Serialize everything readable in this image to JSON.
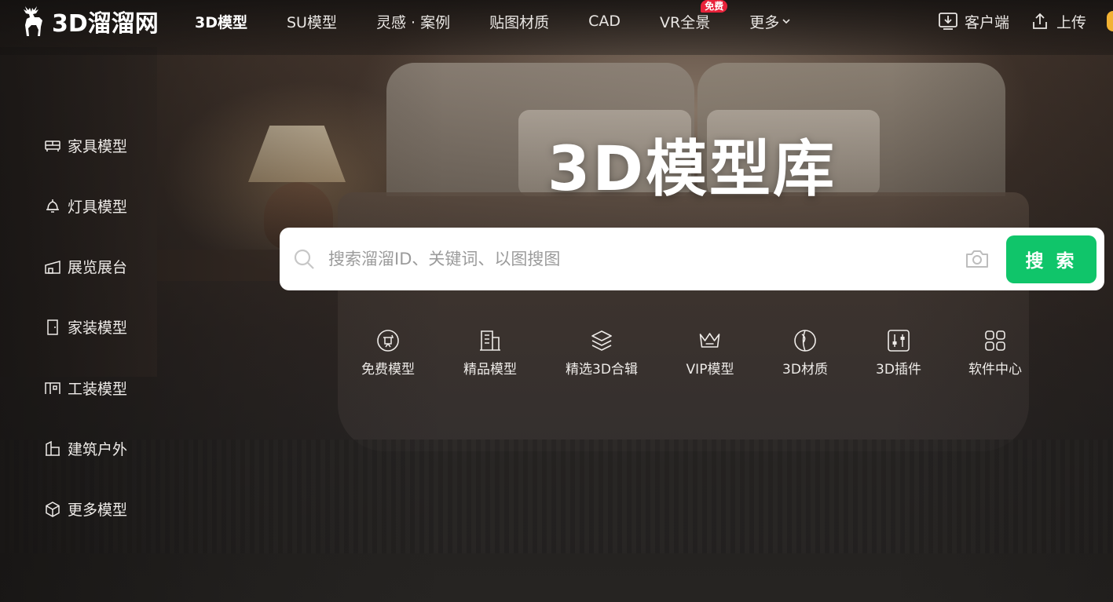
{
  "brand": {
    "logo_text": "3D溜溜网"
  },
  "nav": {
    "items": [
      {
        "label": "3D模型",
        "active": true
      },
      {
        "label": "SU模型"
      },
      {
        "label": "灵感 · 案例"
      },
      {
        "label": "贴图材质"
      },
      {
        "label": "CAD"
      },
      {
        "label": "VR全景",
        "badge": "免费"
      },
      {
        "label": "更多",
        "icon": "chevron-down-icon"
      }
    ]
  },
  "header_right": {
    "client_label": "客户端",
    "client_icon": "download-icon",
    "upload_label": "上传",
    "upload_icon": "upload-icon"
  },
  "sidebar": {
    "items": [
      {
        "label": "家具模型",
        "icon": "sofa-icon"
      },
      {
        "label": "灯具模型",
        "icon": "lamp-icon"
      },
      {
        "label": "展览展台",
        "icon": "booth-icon"
      },
      {
        "label": "家装模型",
        "icon": "door-icon"
      },
      {
        "label": "工装模型",
        "icon": "office-icon"
      },
      {
        "label": "建筑户外",
        "icon": "building-icon"
      },
      {
        "label": "更多模型",
        "icon": "cube-icon"
      }
    ]
  },
  "hero": {
    "title": "3D模型库",
    "search": {
      "placeholder": "搜索溜溜ID、关键词、以图搜图",
      "value": "",
      "button_label": "搜 索"
    }
  },
  "quick_links": [
    {
      "label": "免费模型",
      "icon": "free-icon"
    },
    {
      "label": "精品模型",
      "icon": "building-quality-icon"
    },
    {
      "label": "精选3D合辑",
      "icon": "layers-icon"
    },
    {
      "label": "VIP模型",
      "icon": "crown-icon"
    },
    {
      "label": "3D材质",
      "icon": "material-icon"
    },
    {
      "label": "3D插件",
      "icon": "plugin-icon"
    },
    {
      "label": "软件中心",
      "icon": "grid-icon"
    }
  ],
  "colors": {
    "accent_green": "#10c56a",
    "badge_red": "#e8223a",
    "text_light": "#eeebe8"
  }
}
